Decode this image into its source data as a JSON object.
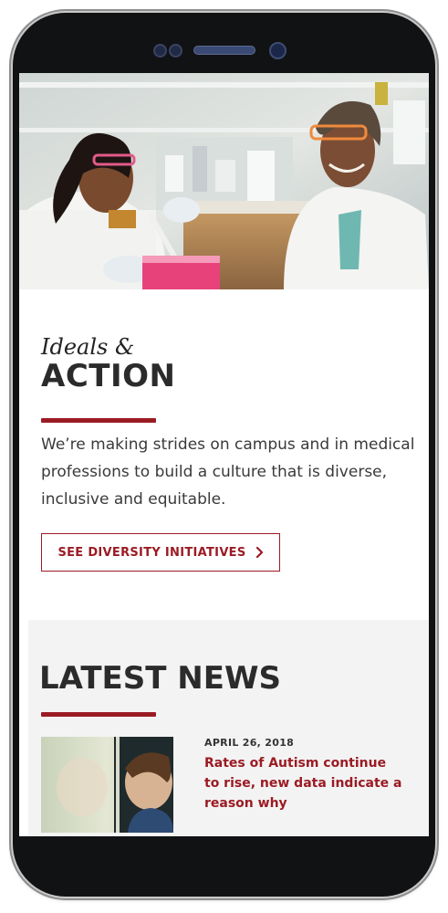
{
  "device": {
    "frame_color": "#111214"
  },
  "hero": {
    "image_description": "two-scientists-in-lab-icon"
  },
  "feature": {
    "kicker": "Ideals &",
    "heading": "ACTION",
    "body": "We’re making strides on campus and in medical professions to build a culture that is diverse, inclusive and equitable.",
    "cta_label": "SEE DIVERSITY INITIATIVES",
    "cta_icon": "chevron-right-icon",
    "accent_color": "#9b1b24"
  },
  "news": {
    "section_title": "LATEST NEWS",
    "items": [
      {
        "date": "APRIL 26, 2018",
        "headline": "Rates of Autism continue to rise, new data indicate a reason why",
        "thumbnail_icon": "child-at-window-icon"
      }
    ]
  }
}
